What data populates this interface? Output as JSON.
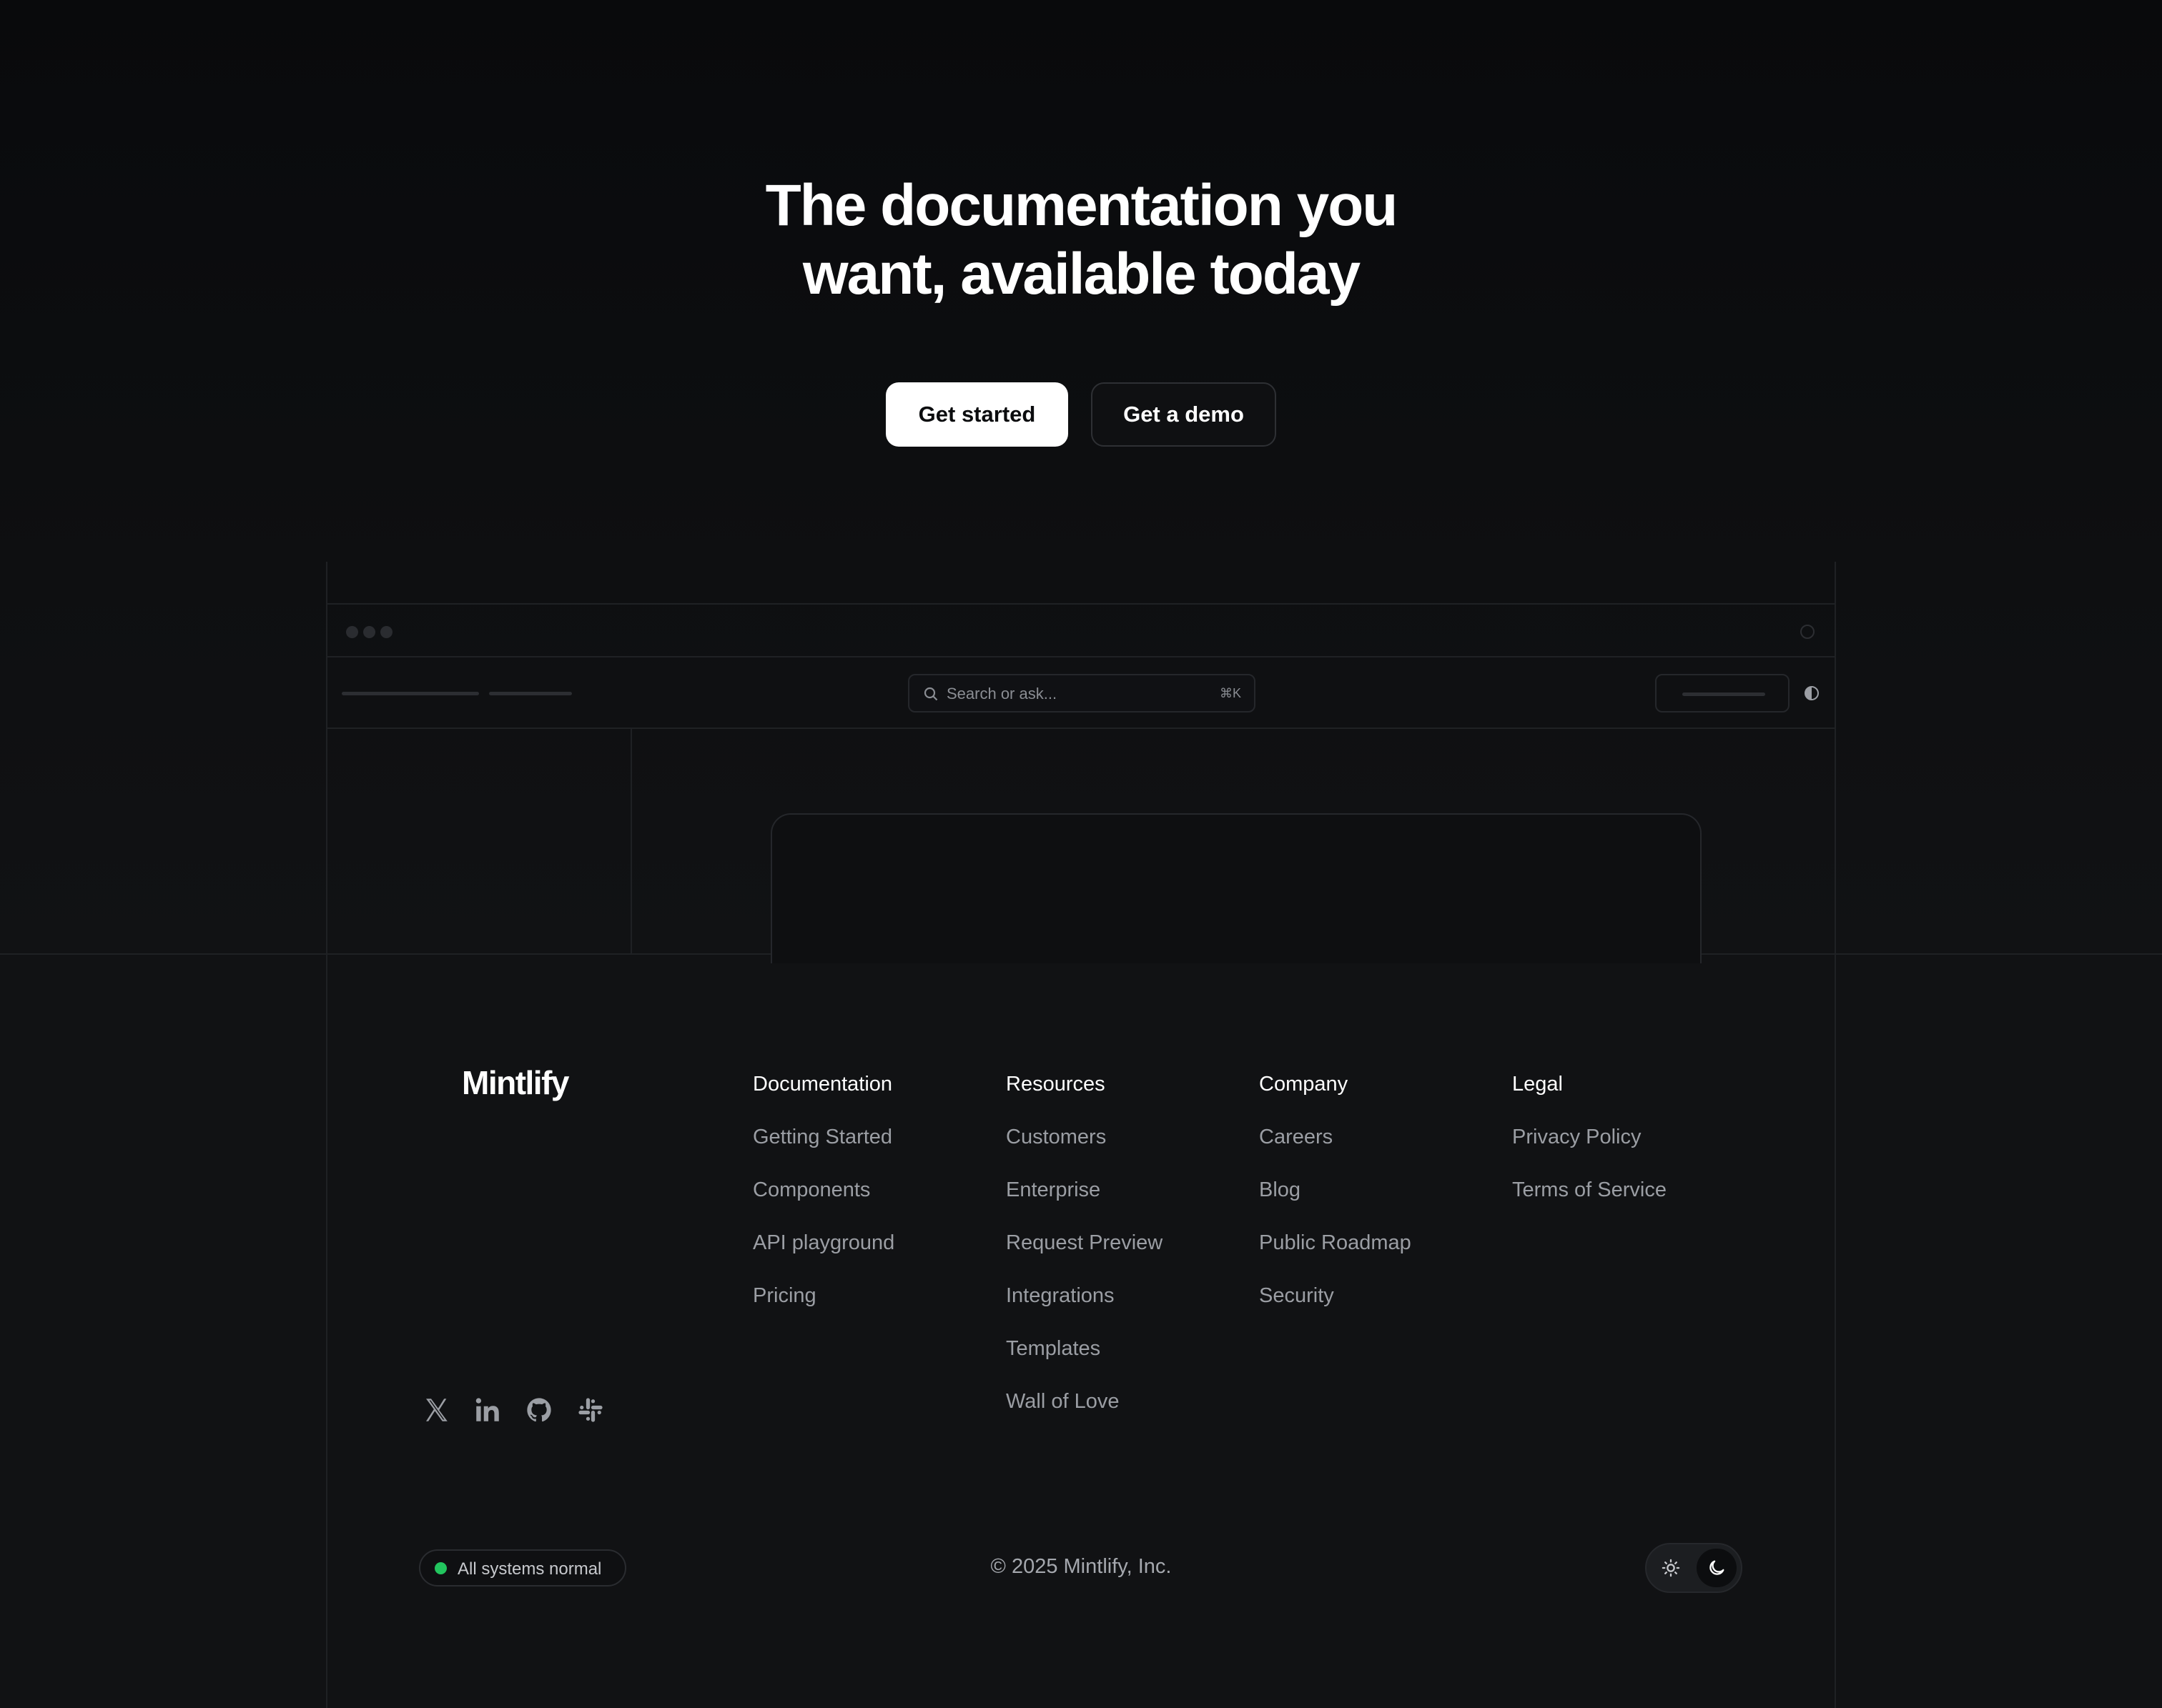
{
  "hero": {
    "title_line1": "The documentation you",
    "title_line2": "want, available today",
    "primary_button": "Get started",
    "secondary_button": "Get a demo"
  },
  "mock_browser": {
    "search_placeholder": "Search or ask...",
    "search_shortcut": "⌘K"
  },
  "footer": {
    "logo": "Mintlify",
    "columns": [
      {
        "heading": "Documentation",
        "links": [
          "Getting Started",
          "Components",
          "API playground",
          "Pricing"
        ]
      },
      {
        "heading": "Resources",
        "links": [
          "Customers",
          "Enterprise",
          "Request Preview",
          "Integrations",
          "Templates",
          "Wall of Love"
        ]
      },
      {
        "heading": "Company",
        "links": [
          "Careers",
          "Blog",
          "Public Roadmap",
          "Security"
        ]
      },
      {
        "heading": "Legal",
        "links": [
          "Privacy Policy",
          "Terms of Service"
        ]
      }
    ],
    "social_icons": [
      "x-icon",
      "linkedin-icon",
      "github-icon",
      "slack-icon"
    ],
    "status_text": "All systems normal",
    "status_color": "#22c55e",
    "copyright": "© 2025 Mintlify, Inc.",
    "theme_options": [
      "sun-icon",
      "moon-icon"
    ],
    "theme_selected": "dark"
  }
}
